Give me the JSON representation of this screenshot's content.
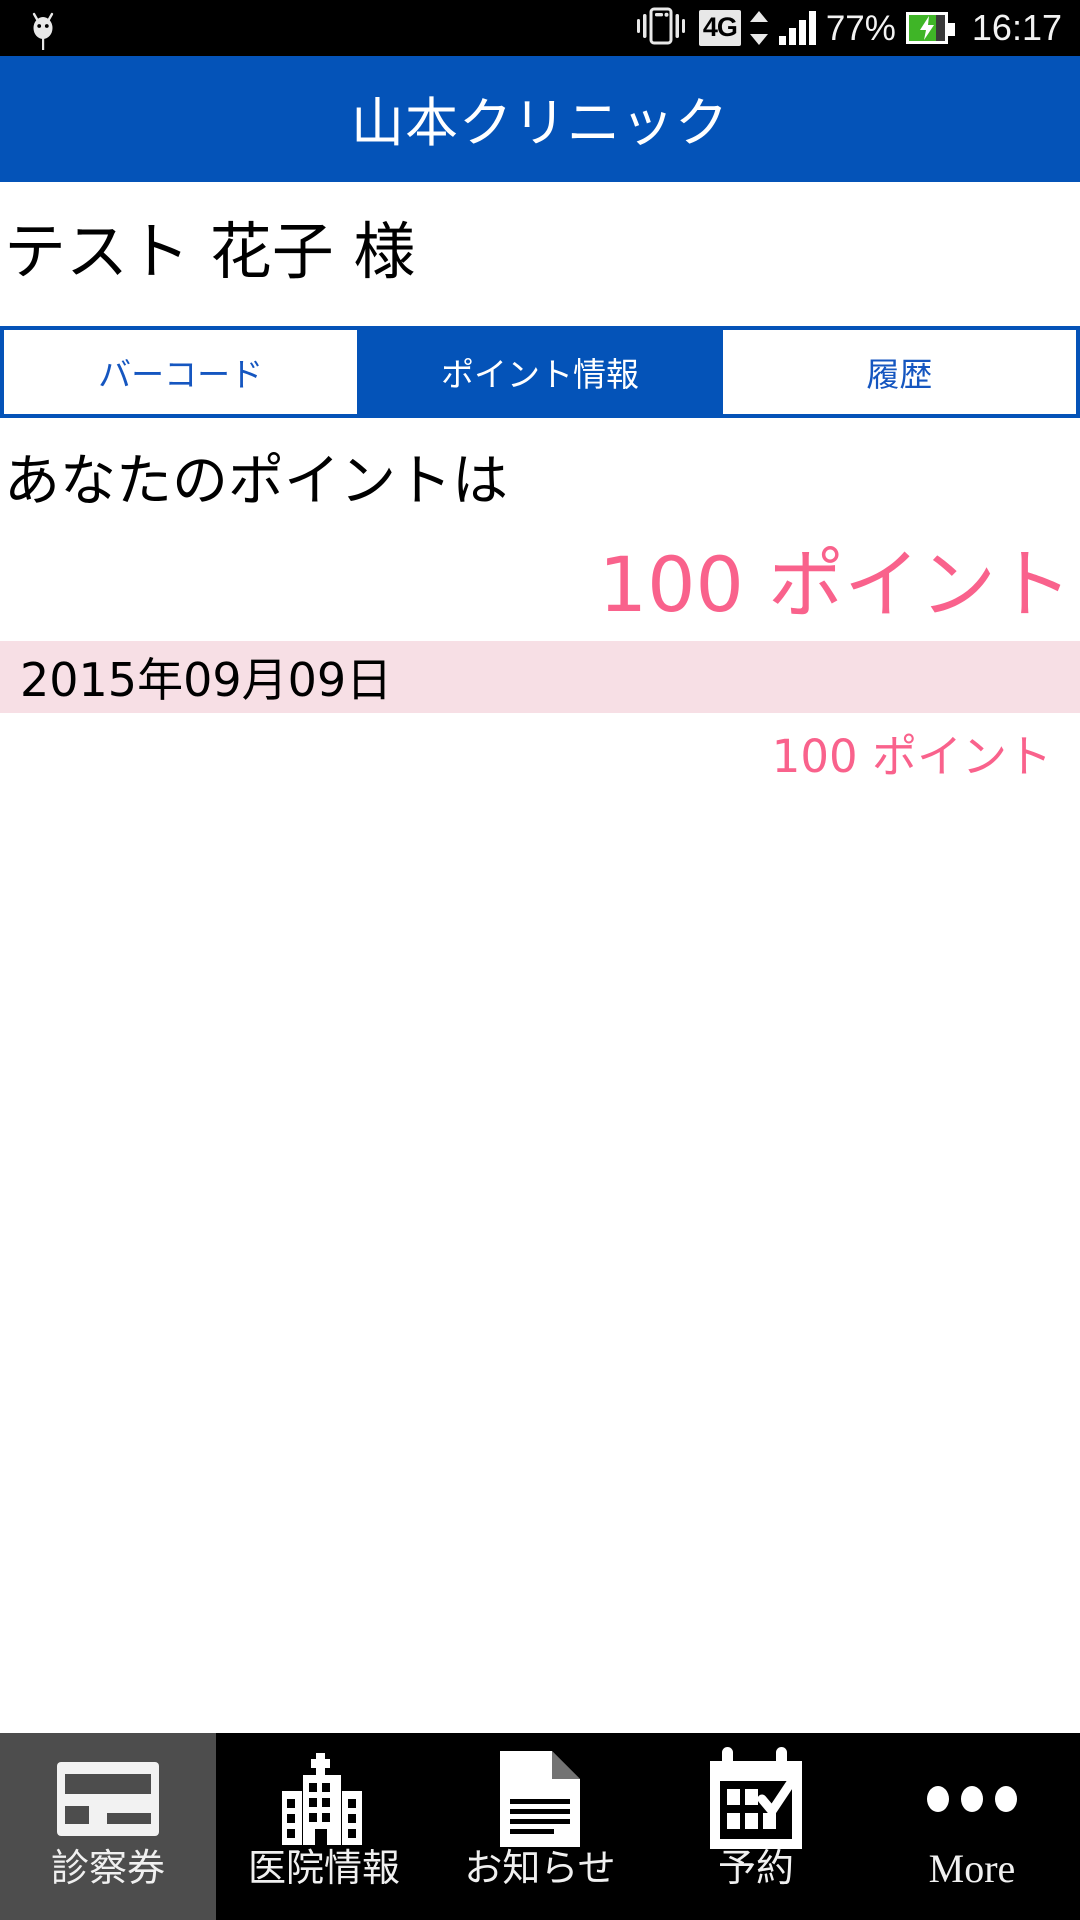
{
  "status_bar": {
    "notification_icon": "android-robot-icon",
    "vibrate_icon": "vibrate-icon",
    "network_type": "4G",
    "data_transfer_icon": "data-updown-icon",
    "signal_icon": "signal-bars-icon",
    "battery_percent": "77%",
    "battery_icon": "battery-charging-icon",
    "time": "16:17"
  },
  "header": {
    "title": "山本クリニック"
  },
  "patient": {
    "name": "テスト 花子 様"
  },
  "tabs": [
    {
      "label": "バーコード",
      "active": false
    },
    {
      "label": "ポイント情報",
      "active": true
    },
    {
      "label": "履歴",
      "active": false
    }
  ],
  "points": {
    "label": "あなたのポイントは",
    "total": "100 ポイント"
  },
  "history": [
    {
      "date": "2015年09月09日",
      "value": "100 ポイント"
    }
  ],
  "bottom_nav": [
    {
      "label": "診察券",
      "icon": "membership-card-icon",
      "selected": true
    },
    {
      "label": "医院情報",
      "icon": "hospital-building-icon",
      "selected": false
    },
    {
      "label": "お知らせ",
      "icon": "document-news-icon",
      "selected": false
    },
    {
      "label": "予約",
      "icon": "calendar-checklist-icon",
      "selected": false
    },
    {
      "label": "More",
      "icon": "ellipsis-icon",
      "selected": false
    }
  ],
  "colors": {
    "brand_blue": "#0453b8",
    "accent_pink": "#f9628c",
    "row_pink_bg": "#f7dfe5",
    "nav_selected_gray": "#4d4d4d",
    "battery_green": "#3fb527"
  }
}
